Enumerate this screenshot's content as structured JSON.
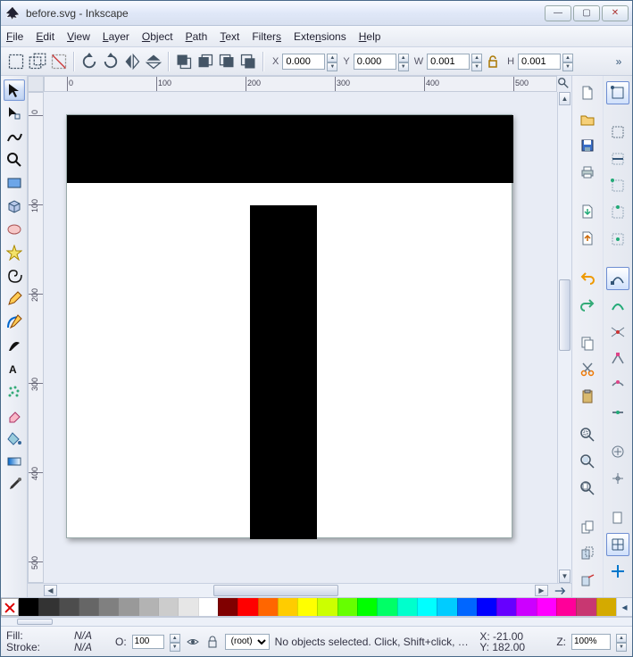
{
  "window": {
    "title": "before.svg - Inkscape"
  },
  "menu": {
    "file": "File",
    "edit": "Edit",
    "view": "View",
    "layer": "Layer",
    "object": "Object",
    "path": "Path",
    "text": "Text",
    "filters": "Filters",
    "extensions": "Extensions",
    "help": "Help"
  },
  "toolbar": {
    "x_label": "X",
    "x_value": "0.000",
    "y_label": "Y",
    "y_value": "0.000",
    "w_label": "W",
    "w_value": "0.001",
    "h_label": "H",
    "h_value": "0.001"
  },
  "ruler": {
    "h_ticks": [
      0,
      100,
      200,
      300,
      400,
      500
    ],
    "v_ticks": [
      0,
      100,
      200,
      300,
      400,
      500
    ]
  },
  "palette": [
    "#000000",
    "#333333",
    "#4d4d4d",
    "#666666",
    "#808080",
    "#999999",
    "#b3b3b3",
    "#cccccc",
    "#e6e6e6",
    "#ffffff",
    "#800000",
    "#ff0000",
    "#ff6600",
    "#ffcc00",
    "#ffff00",
    "#ccff00",
    "#66ff00",
    "#00ff00",
    "#00ff66",
    "#00ffcc",
    "#00ffff",
    "#00ccff",
    "#0066ff",
    "#0000ff",
    "#6600ff",
    "#cc00ff",
    "#ff00ff",
    "#ff0099",
    "#c83771",
    "#d4aa00"
  ],
  "status": {
    "fill_label": "Fill:",
    "fill_value": "N/A",
    "stroke_label": "Stroke:",
    "stroke_value": "N/A",
    "opacity_label": "O:",
    "opacity_value": "100",
    "layer_value": "(root)",
    "message": "No objects selected. Click, Shift+click, or dra",
    "x_label": "X:",
    "x_value": "-21.00",
    "y_label": "Y:",
    "y_value": "182.00",
    "z_label": "Z:",
    "zoom_value": "100%"
  }
}
